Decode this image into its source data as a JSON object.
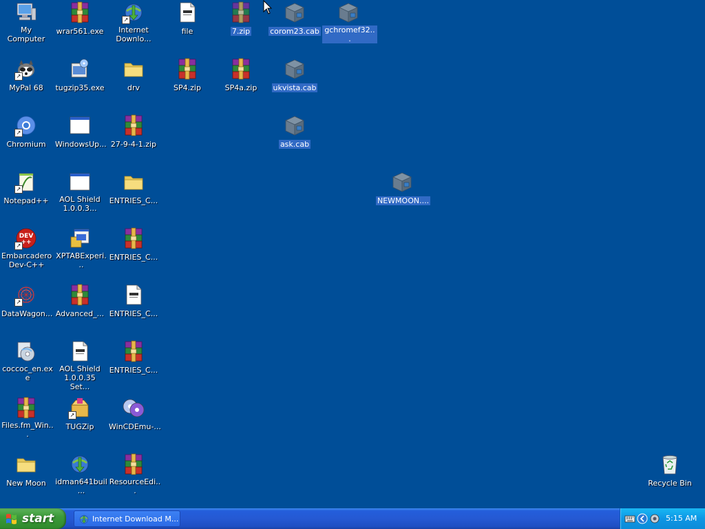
{
  "desktop": {
    "background_color": "#004e98",
    "icons": [
      {
        "label": "My Computer",
        "icon": "my-computer-icon",
        "selected": false
      },
      {
        "label": "wrar561.exe",
        "icon": "winrar-icon",
        "selected": false
      },
      {
        "label": "Internet Downlo...",
        "icon": "internet-download-manager-icon",
        "selected": false
      },
      {
        "label": "file",
        "icon": "text-document-icon",
        "selected": false
      },
      {
        "label": "7.zip",
        "icon": "winrar-archive-icon",
        "selected": true
      },
      {
        "label": "corom23.cab",
        "icon": "cab-archive-icon",
        "selected": true
      },
      {
        "label": "gchromef32...",
        "icon": "cab-archive-icon",
        "selected": true
      },
      {
        "label": "MyPal 68",
        "icon": "mypal-browser-icon",
        "selected": false
      },
      {
        "label": "tugzip35.exe",
        "icon": "installer-icon",
        "selected": false
      },
      {
        "label": "drv",
        "icon": "folder-icon",
        "selected": false
      },
      {
        "label": "SP4.zip",
        "icon": "winrar-archive-icon",
        "selected": false
      },
      {
        "label": "SP4a.zip",
        "icon": "winrar-archive-icon",
        "selected": false
      },
      {
        "label": "ukvista.cab",
        "icon": "cab-archive-icon",
        "selected": true
      },
      {
        "label": "Chromium",
        "icon": "chromium-icon",
        "selected": false
      },
      {
        "label": "WindowsUp...",
        "icon": "window-app-icon",
        "selected": false
      },
      {
        "label": "27-9-4-1.zip",
        "icon": "winrar-archive-icon",
        "selected": false
      },
      {
        "label": "ask.cab",
        "icon": "cab-archive-icon",
        "selected": true
      },
      {
        "label": "Notepad++",
        "icon": "notepad-plus-plus-icon",
        "selected": false
      },
      {
        "label": "AOL Shield 1.0.0.3...",
        "icon": "window-app-icon",
        "selected": false
      },
      {
        "label": "ENTRIES_C...",
        "icon": "folder-icon",
        "selected": false
      },
      {
        "label": "NEWMOON....",
        "icon": "cab-archive-icon",
        "selected": true
      },
      {
        "label": "Embarcadero Dev-C++",
        "icon": "dev-cpp-icon",
        "selected": false
      },
      {
        "label": "XPTABExperi...",
        "icon": "setup-program-icon",
        "selected": false
      },
      {
        "label": "ENTRIES_C...",
        "icon": "winrar-archive-icon",
        "selected": false
      },
      {
        "label": "DataWagon...",
        "icon": "datawagon-icon",
        "selected": false
      },
      {
        "label": "Advanced_...",
        "icon": "winrar-archive-icon",
        "selected": false
      },
      {
        "label": "ENTRIES_C...",
        "icon": "text-document-icon",
        "selected": false
      },
      {
        "label": "coccoc_en.exe",
        "icon": "installer-disc-icon",
        "selected": false
      },
      {
        "label": "AOL Shield 1.0.0.35 Set...",
        "icon": "text-document-icon",
        "selected": false
      },
      {
        "label": "ENTRIES_C...",
        "icon": "winrar-archive-icon",
        "selected": false
      },
      {
        "label": "Files.fm_Win...",
        "icon": "winrar-archive-icon",
        "selected": false
      },
      {
        "label": "TUGZip",
        "icon": "tugzip-icon",
        "selected": false
      },
      {
        "label": "WinCDEmu-...",
        "icon": "wincdemu-icon",
        "selected": false
      },
      {
        "label": "New Moon",
        "icon": "folder-icon",
        "selected": false
      },
      {
        "label": "idman641buil...",
        "icon": "idm-installer-icon",
        "selected": false
      },
      {
        "label": "ResourceEdi...",
        "icon": "winrar-archive-icon",
        "selected": false
      },
      {
        "label": "Recycle Bin",
        "icon": "recycle-bin-icon",
        "selected": false
      }
    ]
  },
  "taskbar": {
    "start_label": "start",
    "tasks": [
      {
        "label": "Internet Download M...",
        "icon": "internet-download-manager-icon"
      }
    ],
    "tray": {
      "icons": [
        "keyboard-icon",
        "chevron-left-icon",
        "speaker-icon"
      ],
      "clock": "5:15 AM"
    }
  },
  "colors": {
    "taskbar_blue": "#245edb",
    "start_green": "#3c9a3a",
    "tray_blue": "#0e96e4",
    "selection_blue": "#316ac5"
  }
}
